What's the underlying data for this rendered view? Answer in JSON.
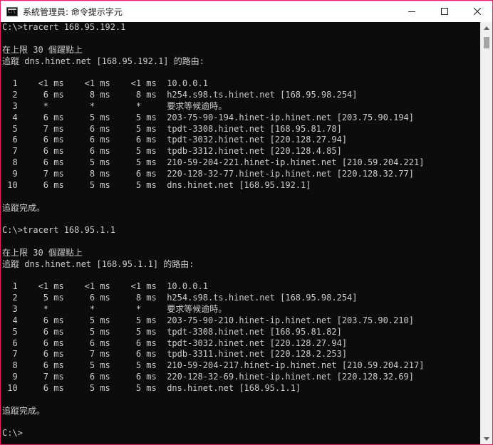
{
  "window": {
    "title": "系統管理員: 命令提示字元",
    "accent": "#e81e63",
    "icons": {
      "app": "console-app-icon",
      "minimize": "minimize-icon",
      "maximize": "maximize-icon",
      "close": "close-icon"
    }
  },
  "console": {
    "foreground": "#cccccc",
    "background": "#0c0c0c",
    "lines": [
      "C:\\>tracert 168.95.192.1",
      "",
      "在上限 30 個躍點上",
      "追蹤 dns.hinet.net [168.95.192.1] 的路由:",
      "",
      "  1    <1 ms    <1 ms    <1 ms  10.0.0.1",
      "  2     6 ms     8 ms     8 ms  h254.s98.ts.hinet.net [168.95.98.254]",
      "  3     *        *        *     要求等候逾時。",
      "  4     6 ms     5 ms     5 ms  203-75-90-194.hinet-ip.hinet.net [203.75.90.194]",
      "  5     7 ms     6 ms     5 ms  tpdt-3308.hinet.net [168.95.81.78]",
      "  6     6 ms     6 ms     6 ms  tpdt-3032.hinet.net [220.128.27.94]",
      "  7     6 ms     6 ms     5 ms  tpdb-3312.hinet.net [220.128.4.85]",
      "  8     6 ms     5 ms     5 ms  210-59-204-221.hinet-ip.hinet.net [210.59.204.221]",
      "  9     7 ms     8 ms     6 ms  220-128-32-77.hinet-ip.hinet.net [220.128.32.77]",
      " 10     6 ms     5 ms     5 ms  dns.hinet.net [168.95.192.1]",
      "",
      "追蹤完成。",
      "",
      "C:\\>tracert 168.95.1.1",
      "",
      "在上限 30 個躍點上",
      "追蹤 dns.hinet.net [168.95.1.1] 的路由:",
      "",
      "  1    <1 ms    <1 ms    <1 ms  10.0.0.1",
      "  2     5 ms     6 ms     8 ms  h254.s98.ts.hinet.net [168.95.98.254]",
      "  3     *        *        *     要求等候逾時。",
      "  4     6 ms     5 ms     5 ms  203-75-90-210.hinet-ip.hinet.net [203.75.90.210]",
      "  5     6 ms     5 ms     5 ms  tpdt-3308.hinet.net [168.95.81.82]",
      "  6     6 ms     6 ms     6 ms  tpdt-3032.hinet.net [220.128.27.94]",
      "  7     6 ms     7 ms     6 ms  tpdb-3311.hinet.net [220.128.2.253]",
      "  8     6 ms     5 ms     5 ms  210-59-204-217.hinet-ip.hinet.net [210.59.204.217]",
      "  9     7 ms     6 ms     6 ms  220-128-32-69.hinet-ip.hinet.net [220.128.32.69]",
      " 10     6 ms     5 ms     5 ms  dns.hinet.net [168.95.1.1]",
      "",
      "追蹤完成。",
      "",
      "C:\\>"
    ]
  },
  "scrollbar": {
    "icons": {
      "up": "scroll-up-arrow-icon",
      "down": "scroll-down-arrow-icon"
    }
  }
}
